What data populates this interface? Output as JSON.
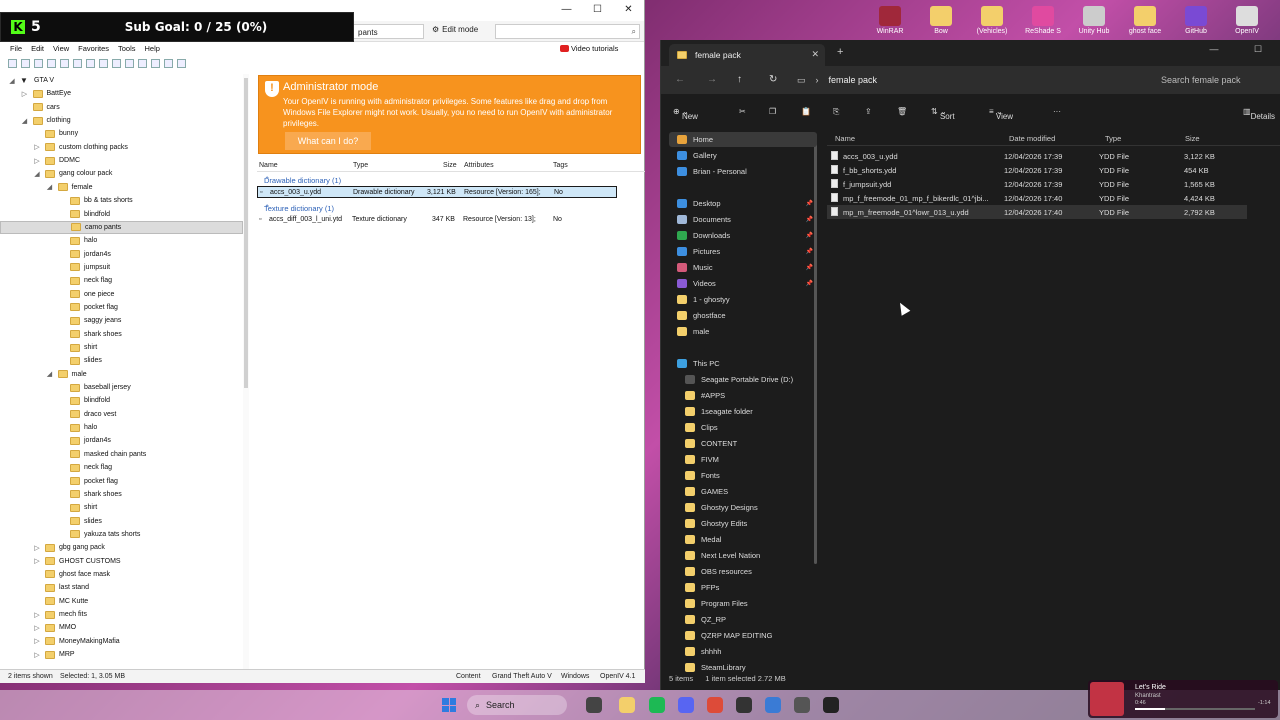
{
  "stream": {
    "count": "5",
    "sub_goal": "Sub Goal: 0 / 25 (0%)"
  },
  "openiv": {
    "tab_label": "pants",
    "edit_mode": "Edit mode",
    "menu": [
      "File",
      "Edit",
      "View",
      "Favorites",
      "Tools",
      "Help"
    ],
    "video_tutorials": "Video tutorials",
    "tree": [
      {
        "label": "GTA V",
        "depth": 0,
        "tog": "◢",
        "root": true
      },
      {
        "label": "BattEye",
        "depth": 1,
        "tog": "▷"
      },
      {
        "label": "cars",
        "depth": 1,
        "tog": ""
      },
      {
        "label": "clothing",
        "depth": 1,
        "tog": "◢"
      },
      {
        "label": "bunny",
        "depth": 2,
        "tog": ""
      },
      {
        "label": "custom clothing packs",
        "depth": 2,
        "tog": "▷"
      },
      {
        "label": "DDMC",
        "depth": 2,
        "tog": "▷"
      },
      {
        "label": "gang colour pack",
        "depth": 2,
        "tog": "◢"
      },
      {
        "label": "female",
        "depth": 3,
        "tog": "◢"
      },
      {
        "label": "bb & tats shorts",
        "depth": 4,
        "tog": ""
      },
      {
        "label": "blindfold",
        "depth": 4,
        "tog": ""
      },
      {
        "label": "camo pants",
        "depth": 4,
        "tog": "",
        "selected": true
      },
      {
        "label": "halo",
        "depth": 4,
        "tog": ""
      },
      {
        "label": "jordan4s",
        "depth": 4,
        "tog": ""
      },
      {
        "label": "jumpsuit",
        "depth": 4,
        "tog": ""
      },
      {
        "label": "neck flag",
        "depth": 4,
        "tog": ""
      },
      {
        "label": "one piece",
        "depth": 4,
        "tog": ""
      },
      {
        "label": "pocket flag",
        "depth": 4,
        "tog": ""
      },
      {
        "label": "saggy jeans",
        "depth": 4,
        "tog": ""
      },
      {
        "label": "shark shoes",
        "depth": 4,
        "tog": ""
      },
      {
        "label": "shirt",
        "depth": 4,
        "tog": ""
      },
      {
        "label": "slides",
        "depth": 4,
        "tog": ""
      },
      {
        "label": "male",
        "depth": 3,
        "tog": "◢"
      },
      {
        "label": "baseball jersey",
        "depth": 4,
        "tog": ""
      },
      {
        "label": "blindfold",
        "depth": 4,
        "tog": ""
      },
      {
        "label": "draco vest",
        "depth": 4,
        "tog": ""
      },
      {
        "label": "halo",
        "depth": 4,
        "tog": ""
      },
      {
        "label": "jordan4s",
        "depth": 4,
        "tog": ""
      },
      {
        "label": "masked chain pants",
        "depth": 4,
        "tog": ""
      },
      {
        "label": "neck flag",
        "depth": 4,
        "tog": ""
      },
      {
        "label": "pocket flag",
        "depth": 4,
        "tog": ""
      },
      {
        "label": "shark shoes",
        "depth": 4,
        "tog": ""
      },
      {
        "label": "shirt",
        "depth": 4,
        "tog": ""
      },
      {
        "label": "slides",
        "depth": 4,
        "tog": ""
      },
      {
        "label": "yakuza tats shorts",
        "depth": 4,
        "tog": ""
      },
      {
        "label": "gbg gang pack",
        "depth": 2,
        "tog": "▷"
      },
      {
        "label": "GHOST CUSTOMS",
        "depth": 2,
        "tog": "▷"
      },
      {
        "label": "ghost face mask",
        "depth": 2,
        "tog": ""
      },
      {
        "label": "last stand",
        "depth": 2,
        "tog": ""
      },
      {
        "label": "MC Kutte",
        "depth": 2,
        "tog": ""
      },
      {
        "label": "mech fits",
        "depth": 2,
        "tog": "▷"
      },
      {
        "label": "MMO",
        "depth": 2,
        "tog": "▷"
      },
      {
        "label": "MoneyMakingMafia",
        "depth": 2,
        "tog": "▷"
      },
      {
        "label": "MRP",
        "depth": 2,
        "tog": "▷"
      }
    ],
    "admin": {
      "title": "Administrator mode",
      "text": "Your OpenIV is running with administrator privileges. Some features like drag and drop from Windows File Explorer might not work. Usually, you no need to run OpenIV with administrator privileges.",
      "button": "What can I do?"
    },
    "columns": [
      "Name",
      "Type",
      "Size",
      "Attributes",
      "Tags"
    ],
    "groups": [
      {
        "label": "Drawable dictionary (1)",
        "files": [
          {
            "name": "accs_003_u.ydd",
            "type": "Drawable dictionary",
            "size": "3,121 KB",
            "attr": "Resource [Version: 165];",
            "tags": "No",
            "selected": true
          }
        ]
      },
      {
        "label": "Texture dictionary (1)",
        "files": [
          {
            "name": "accs_diff_003_l_uni.ytd",
            "type": "Texture dictionary",
            "size": "347 KB",
            "attr": "Resource [Version: 13];",
            "tags": "No"
          }
        ]
      }
    ],
    "status": {
      "left": "2 items shown",
      "selected": "Selected: 1,  3.05 MB",
      "content": "Content",
      "game": "Grand Theft Auto V",
      "os": "Windows",
      "version": "OpenIV 4.1"
    }
  },
  "explorer": {
    "tab_title": "female pack",
    "address": "female pack",
    "search_placeholder": "Search female pack",
    "cmd": {
      "new": "New",
      "sort": "Sort",
      "view": "View",
      "details": "Details"
    },
    "nav": [
      {
        "label": "Home",
        "icon": "home",
        "color": "#e8a33c",
        "highlight": true
      },
      {
        "label": "Gallery",
        "icon": "gallery",
        "color": "#3d8fe0"
      },
      {
        "label": "Brian - Personal",
        "icon": "cloud",
        "color": "#3d8fe0"
      },
      {
        "label": "Desktop",
        "icon": "desktop",
        "color": "#3d8fe0",
        "pinned": true
      },
      {
        "label": "Documents",
        "icon": "documents",
        "color": "#a0b8d8",
        "pinned": true
      },
      {
        "label": "Downloads",
        "icon": "downloads",
        "color": "#2fa84f",
        "pinned": true
      },
      {
        "label": "Pictures",
        "icon": "pictures",
        "color": "#3d8fe0",
        "pinned": true
      },
      {
        "label": "Music",
        "icon": "music",
        "color": "#d45a7a",
        "pinned": true
      },
      {
        "label": "Videos",
        "icon": "videos",
        "color": "#8a5ad4",
        "pinned": true
      },
      {
        "label": "1 - ghostyy",
        "icon": "folder",
        "color": "#f3cf6b"
      },
      {
        "label": "ghostface",
        "icon": "folder",
        "color": "#f3cf6b"
      },
      {
        "label": "male",
        "icon": "folder",
        "color": "#f3cf6b"
      },
      {
        "label": "This PC",
        "icon": "pc",
        "color": "#3da0e0",
        "gap": true
      },
      {
        "label": "Seagate Portable Drive (D:)",
        "icon": "drive",
        "color": "#555"
      },
      {
        "label": "#APPS",
        "icon": "folder",
        "color": "#f3cf6b"
      },
      {
        "label": "1seagate folder",
        "icon": "folder",
        "color": "#f3cf6b"
      },
      {
        "label": "Clips",
        "icon": "folder",
        "color": "#f3cf6b"
      },
      {
        "label": "CONTENT",
        "icon": "folder",
        "color": "#f3cf6b"
      },
      {
        "label": "FIVM",
        "icon": "folder",
        "color": "#f3cf6b"
      },
      {
        "label": "Fonts",
        "icon": "folder",
        "color": "#f3cf6b"
      },
      {
        "label": "GAMES",
        "icon": "folder",
        "color": "#f3cf6b"
      },
      {
        "label": "Ghostyy Designs",
        "icon": "folder",
        "color": "#f3cf6b"
      },
      {
        "label": "Ghostyy Edits",
        "icon": "folder",
        "color": "#f3cf6b"
      },
      {
        "label": "Medal",
        "icon": "folder",
        "color": "#f3cf6b"
      },
      {
        "label": "Next Level Nation",
        "icon": "folder",
        "color": "#f3cf6b"
      },
      {
        "label": "OBS resources",
        "icon": "folder",
        "color": "#f3cf6b"
      },
      {
        "label": "PFPs",
        "icon": "folder",
        "color": "#f3cf6b"
      },
      {
        "label": "Program Files",
        "icon": "folder",
        "color": "#f3cf6b"
      },
      {
        "label": "QZ_RP",
        "icon": "folder",
        "color": "#f3cf6b"
      },
      {
        "label": "QZRP MAP EDITING",
        "icon": "folder",
        "color": "#f3cf6b"
      },
      {
        "label": "shhhh",
        "icon": "folder",
        "color": "#f3cf6b"
      },
      {
        "label": "SteamLibrary",
        "icon": "folder",
        "color": "#f3cf6b"
      }
    ],
    "columns": [
      "Name",
      "Date modified",
      "Type",
      "Size"
    ],
    "files": [
      {
        "name": "accs_003_u.ydd",
        "date": "12/04/2026 17:39",
        "type": "YDD File",
        "size": "3,122 KB"
      },
      {
        "name": "f_bb_shorts.ydd",
        "date": "12/04/2026 17:39",
        "type": "YDD File",
        "size": "454 KB"
      },
      {
        "name": "f_jumpsuit.ydd",
        "date": "12/04/2026 17:39",
        "type": "YDD File",
        "size": "1,565 KB"
      },
      {
        "name": "mp_f_freemode_01_mp_f_bikerdlc_01^jbi...",
        "date": "12/04/2026 17:40",
        "type": "YDD File",
        "size": "4,424 KB"
      },
      {
        "name": "mp_m_freemode_01^lowr_013_u.ydd",
        "date": "12/04/2026 17:40",
        "type": "YDD File",
        "size": "2,792 KB",
        "selected": true
      }
    ],
    "status": {
      "items": "5 items",
      "selected": "1 item selected  2.72 MB"
    }
  },
  "desktop_icons": [
    {
      "label": "WinRAR",
      "color": "#a0283a"
    },
    {
      "label": "Bow",
      "color": "#f3cf6b"
    },
    {
      "label": "(Vehicles)",
      "color": "#f3cf6b"
    },
    {
      "label": "ReShade S",
      "color": "#e04aa0"
    },
    {
      "label": "Unity Hub",
      "color": "#cccccc"
    },
    {
      "label": "ghost face",
      "color": "#f3cf6b"
    },
    {
      "label": "GitHub",
      "color": "#7a4ad4"
    },
    {
      "label": "OpenIV",
      "color": "#dddddd"
    }
  ],
  "taskbar": {
    "search": "Search"
  },
  "music": {
    "title": "Let's Ride",
    "artist": "Khantrast",
    "elapsed": "0:46",
    "remaining": "-1:14"
  }
}
